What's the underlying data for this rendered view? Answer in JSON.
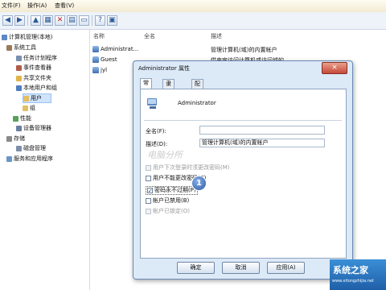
{
  "menu": {
    "items": [
      "文件(F)",
      "操作(A)",
      "查看(V)"
    ]
  },
  "tree": {
    "items": [
      {
        "label": "计算机管理(本地)"
      },
      {
        "label": "系统工具"
      },
      {
        "label": "任务计划程序"
      },
      {
        "label": "事件查看器"
      },
      {
        "label": "共享文件夹"
      },
      {
        "label": "本地用户和组"
      },
      {
        "label": "用户"
      },
      {
        "label": "组"
      },
      {
        "label": "性能"
      },
      {
        "label": "设备管理器"
      },
      {
        "label": "存储"
      },
      {
        "label": "磁盘管理"
      },
      {
        "label": "服务和应用程序"
      }
    ]
  },
  "list": {
    "headers": [
      "名称",
      "全名",
      "描述"
    ],
    "rows": [
      {
        "name": "Administrat...",
        "fullname": "",
        "desc": "管理计算机(域)的内置帐户"
      },
      {
        "name": "Guest",
        "fullname": "",
        "desc": "供来宾访问计算机或访问域的..."
      },
      {
        "name": "jyl",
        "fullname": "",
        "desc": ""
      }
    ]
  },
  "dialog": {
    "title": "Administrator 属性",
    "close": "×",
    "tabs": [
      "常规",
      "隶属于",
      "配置文件"
    ],
    "username": "Administrator",
    "fullname_label": "全名(F):",
    "fullname_value": "",
    "desc_label": "描述(D):",
    "desc_value": "管理计算机(域)的内置帐户",
    "checkboxes": [
      {
        "label": "用户下次登录时须更改密码(M)",
        "checked": false,
        "disabled": true
      },
      {
        "label": "用户不能更改密码(C)",
        "checked": false,
        "disabled": false
      },
      {
        "label": "密码永不过期(P)",
        "checked": true,
        "disabled": false
      },
      {
        "label": "帐户已禁用(B)",
        "checked": false,
        "disabled": false
      },
      {
        "label": "帐户已锁定(O)",
        "checked": false,
        "disabled": true
      }
    ],
    "step_badge": "1",
    "ok": "确定",
    "cancel": "取消",
    "apply": "应用(A)"
  },
  "watermark": "电脑分所",
  "brand": {
    "name": "系统之家",
    "url": "www.xitongzhijia.net"
  },
  "colors": {
    "selection": "#cfe3fb",
    "dialog_bg": "#dce9f7",
    "brand": "#1f5fa8"
  }
}
